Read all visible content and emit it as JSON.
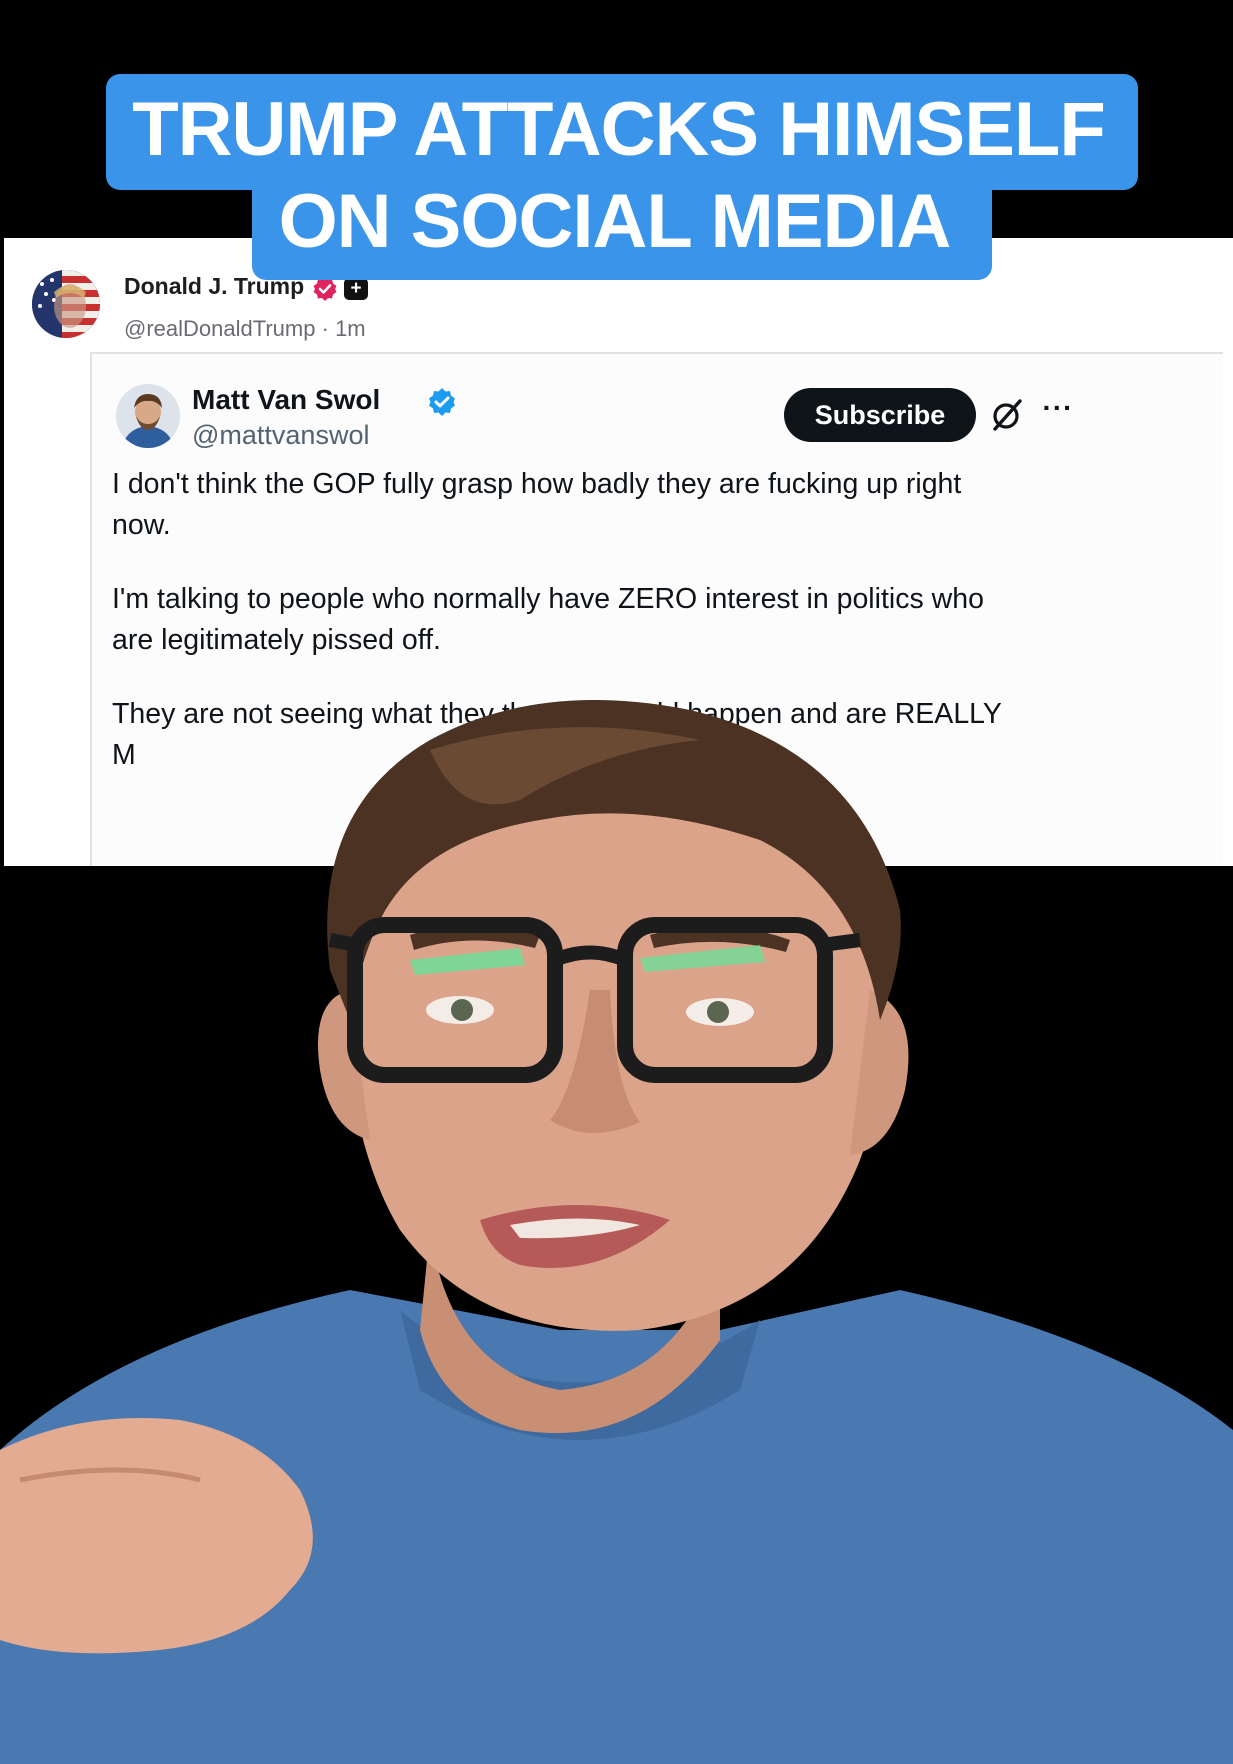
{
  "headline": {
    "line1": "TRUMP ATTACKS HIMSELF",
    "line2": "ON SOCIAL MEDIA"
  },
  "post": {
    "author_name": "Donald J. Trump",
    "author_handle": "@realDonaldTrump",
    "time_ago": "1m",
    "plus_badge": "+"
  },
  "quoted_tweet": {
    "name": "Matt Van Swol",
    "handle": "@mattvanswol",
    "subscribe_label": "Subscribe",
    "more_label": "···",
    "paragraphs": [
      "I don't think the GOP fully grasp how badly they are fucking up right now.",
      "I'm talking to people who normally have ZERO interest in politics who are legitimately pissed off.",
      "They are not seeing what they thought would happen and are REALLY M"
    ]
  },
  "icons": {
    "verified_pink": "verified-badge-icon",
    "verified_blue": "verified-badge-icon",
    "grok": "grok-icon",
    "more": "more-options-icon"
  },
  "colors": {
    "headline_bg": "#3a95ea",
    "headline_text": "#ffffff",
    "background": "#000000",
    "verified_blue": "#1d9bf0",
    "verified_pink": "#e0245e",
    "subscribe_bg": "#0f1419"
  }
}
